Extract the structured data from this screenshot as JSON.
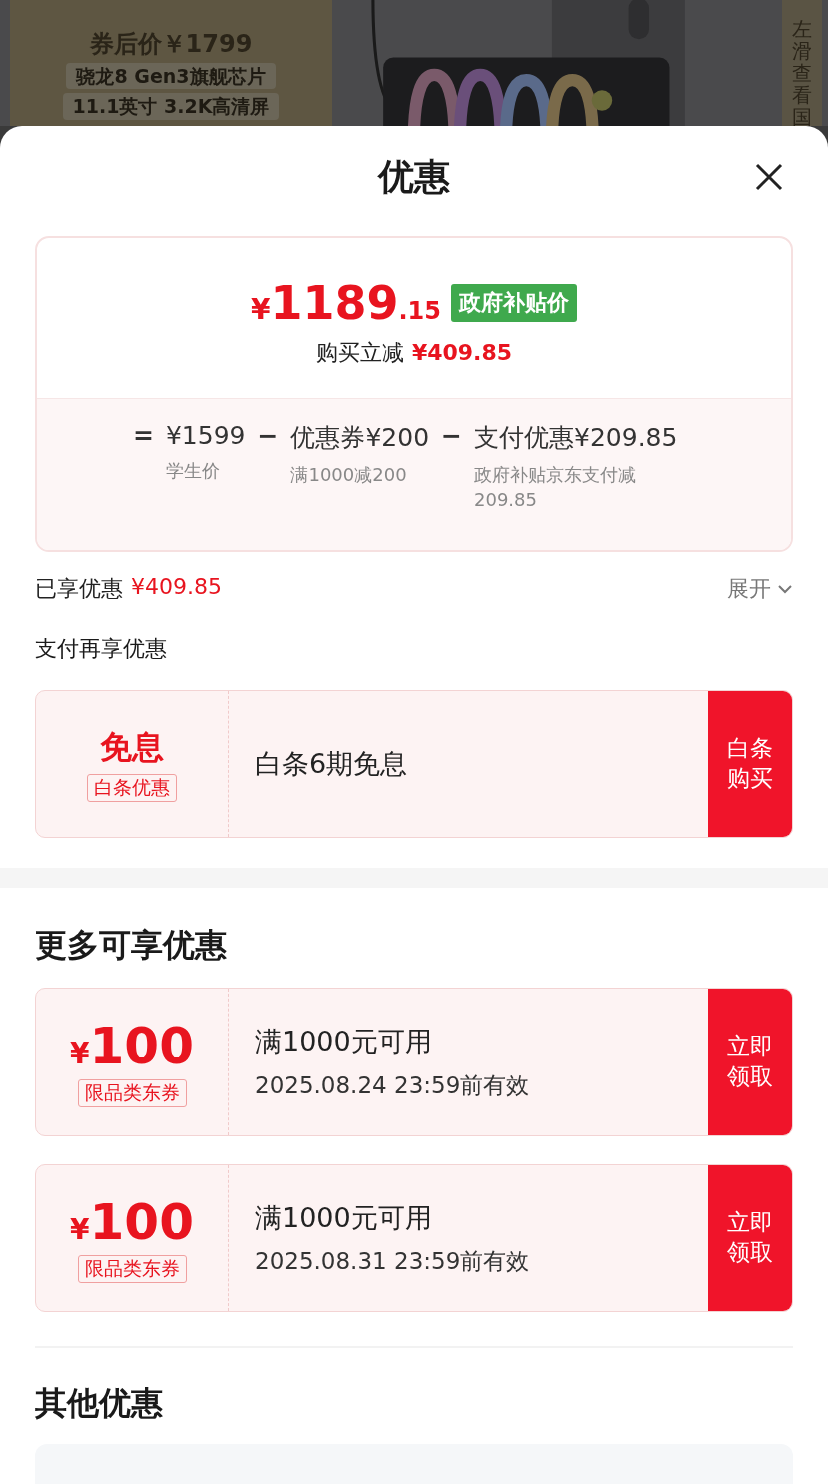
{
  "banner": {
    "price": "券后价￥1799",
    "features": [
      "骁龙8 Gen3旗舰芯片",
      "11.1英寸 3.2K高清屏"
    ],
    "side_text": "左滑查看国"
  },
  "sheet": {
    "title": "优惠"
  },
  "price_card": {
    "currency": "¥",
    "integer": "1189",
    "decimal": ".15",
    "tag": "政府补贴价",
    "reduce_label": "购买立减",
    "reduce_amount": "¥409.85",
    "terms": [
      {
        "op": "=",
        "value": "¥1599",
        "note": "学生价"
      },
      {
        "op": "−",
        "name": "优惠券",
        "value": "¥200",
        "note": "满1000减200"
      },
      {
        "op": "−",
        "name": "支付优惠",
        "value": "¥209.85",
        "note": "政府补贴京东支付减209.85"
      }
    ]
  },
  "enjoyed": {
    "label": "已享优惠",
    "amount": "¥409.85",
    "toggle": "展开",
    "expanded": false
  },
  "pay_section": {
    "title": "支付再享优惠",
    "offers": [
      {
        "kind": "interest",
        "headline": "免息",
        "tag": "白条优惠",
        "text": "白条6期免息",
        "action": "白条购买"
      }
    ]
  },
  "more_section": {
    "title": "更多可享优惠",
    "coupons": [
      {
        "kind": "coupon",
        "currency": "¥",
        "amount": "100",
        "tag": "限品类东券",
        "condition": "满1000元可用",
        "validity": "2025.08.24 23:59前有效",
        "action": "立即领取"
      },
      {
        "kind": "coupon",
        "currency": "¥",
        "amount": "100",
        "tag": "限品类东券",
        "condition": "满1000元可用",
        "validity": "2025.08.31 23:59前有效",
        "action": "立即领取"
      }
    ]
  },
  "other_section": {
    "title": "其他优惠"
  }
}
